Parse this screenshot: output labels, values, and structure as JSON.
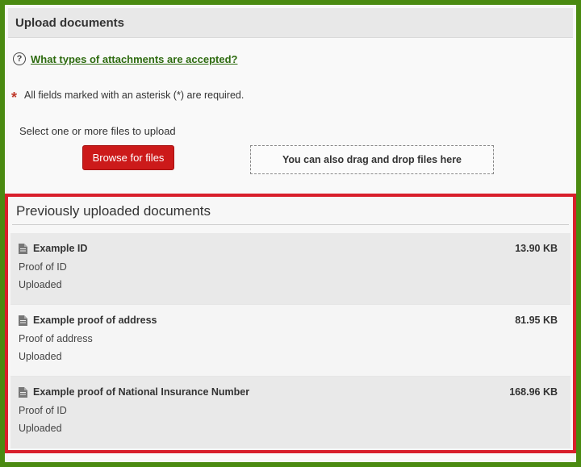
{
  "header": {
    "title": "Upload documents"
  },
  "help": {
    "link_text": "What types of attachments are accepted?",
    "icon": "question-circle-icon"
  },
  "required": {
    "marker": "*",
    "text": "All fields marked with an asterisk (*) are required."
  },
  "upload": {
    "label": "Select one or more files to upload",
    "browse_label": "Browse for files",
    "drop_label": "You can also drag and drop files here"
  },
  "previous": {
    "title": "Previously uploaded documents",
    "items": [
      {
        "name": "Example ID",
        "size": "13.90 KB",
        "type": "Proof of ID",
        "status": "Uploaded"
      },
      {
        "name": "Example proof of address",
        "size": "81.95 KB",
        "type": "Proof of address",
        "status": "Uploaded"
      },
      {
        "name": "Example proof of National Insurance Number",
        "size": "168.96 KB",
        "type": "Proof of ID",
        "status": "Uploaded"
      }
    ]
  },
  "colors": {
    "frame": "#4a8a10",
    "highlight": "#d81f2b",
    "button": "#cc1a1a",
    "link": "#2e6b10"
  }
}
